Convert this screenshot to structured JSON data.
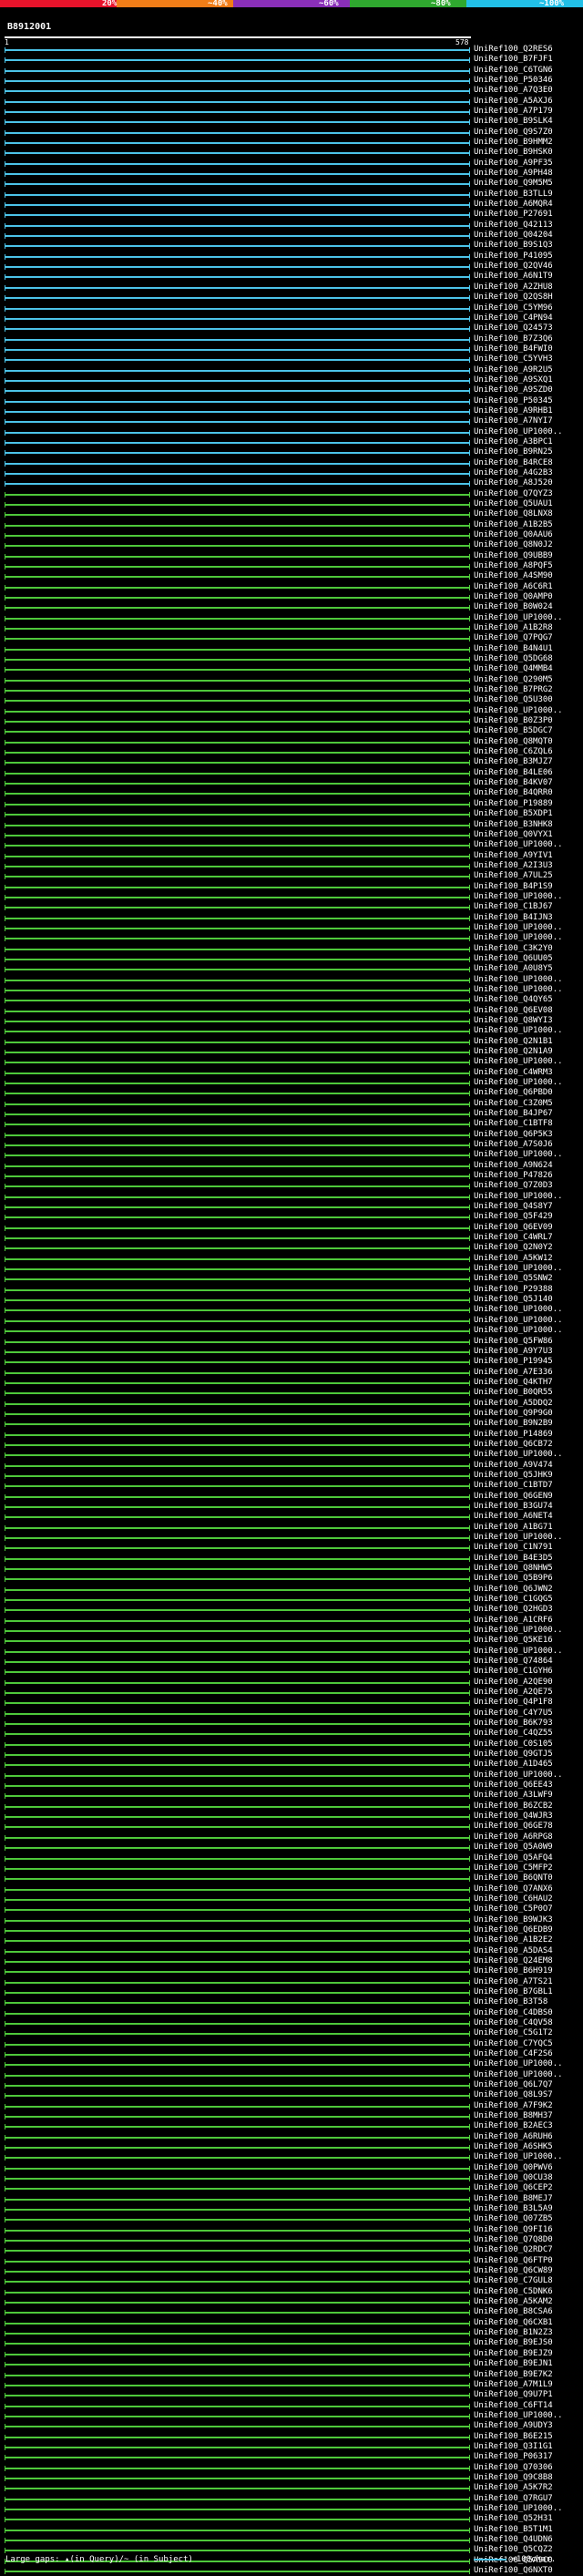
{
  "identity_scale": {
    "labels": [
      "20%",
      "~40%",
      "~60%",
      "~80%",
      "~100%"
    ],
    "colors": [
      "#e8132b",
      "#f07d18",
      "#8a2fb8",
      "#2fa82f",
      "#22c0e8"
    ]
  },
  "query": {
    "id": "B8912001",
    "start": "1",
    "end": "578"
  },
  "hits": [
    {
      "label": "UniRef100_Q2RES6",
      "color": "blue"
    },
    {
      "label": "UniRef100_B7FJF1",
      "color": "blue"
    },
    {
      "label": "UniRef100_C6TGN6",
      "color": "blue"
    },
    {
      "label": "UniRef100_P50346",
      "color": "blue"
    },
    {
      "label": "UniRef100_A7Q3E0",
      "color": "blue"
    },
    {
      "label": "UniRef100_A5AXJ6",
      "color": "blue"
    },
    {
      "label": "UniRef100_A7P179",
      "color": "blue"
    },
    {
      "label": "UniRef100_B9SLK4",
      "color": "blue"
    },
    {
      "label": "UniRef100_Q9S7Z0",
      "color": "blue"
    },
    {
      "label": "UniRef100_B9HMM2",
      "color": "blue"
    },
    {
      "label": "UniRef100_B9HSK0",
      "color": "blue"
    },
    {
      "label": "UniRef100_A9PF35",
      "color": "blue"
    },
    {
      "label": "UniRef100_A9PH48",
      "color": "blue"
    },
    {
      "label": "UniRef100_Q9M5M5",
      "color": "blue"
    },
    {
      "label": "UniRef100_B3TLL9",
      "color": "blue"
    },
    {
      "label": "UniRef100_A6MQR4",
      "color": "blue"
    },
    {
      "label": "UniRef100_P27691",
      "color": "blue"
    },
    {
      "label": "UniRef100_Q42113",
      "color": "blue"
    },
    {
      "label": "UniRef100_Q04204",
      "color": "blue"
    },
    {
      "label": "UniRef100_B9S1Q3",
      "color": "blue"
    },
    {
      "label": "UniRef100_P41095",
      "color": "blue"
    },
    {
      "label": "UniRef100_Q2QV46",
      "color": "blue"
    },
    {
      "label": "UniRef100_A6N1T9",
      "color": "blue"
    },
    {
      "label": "UniRef100_A2ZHU8",
      "color": "blue"
    },
    {
      "label": "UniRef100_Q2QS8H",
      "color": "blue"
    },
    {
      "label": "UniRef100_C5YM96",
      "color": "blue"
    },
    {
      "label": "UniRef100_C4PN94",
      "color": "blue"
    },
    {
      "label": "UniRef100_Q24573",
      "color": "blue"
    },
    {
      "label": "UniRef100_B7Z3Q6",
      "color": "blue"
    },
    {
      "label": "UniRef100_B4FWI0",
      "color": "blue"
    },
    {
      "label": "UniRef100_C5YVH3",
      "color": "blue"
    },
    {
      "label": "UniRef100_A9R2U5",
      "color": "blue"
    },
    {
      "label": "UniRef100_A9SXQ1",
      "color": "blue"
    },
    {
      "label": "UniRef100_A9SZD0",
      "color": "blue"
    },
    {
      "label": "UniRef100_P50345",
      "color": "blue"
    },
    {
      "label": "UniRef100_A9RHB1",
      "color": "blue"
    },
    {
      "label": "UniRef100_A7NYI7",
      "color": "blue"
    },
    {
      "label": "UniRef100_UP1000..",
      "color": "blue"
    },
    {
      "label": "UniRef100_A3BPC1",
      "color": "blue"
    },
    {
      "label": "UniRef100_B9RN25",
      "color": "blue"
    },
    {
      "label": "UniRef100_B4RCE8",
      "color": "blue"
    },
    {
      "label": "UniRef100_A4G2B3",
      "color": "blue"
    },
    {
      "label": "UniRef100_A8J520",
      "color": "blue"
    },
    {
      "label": "UniRef100_Q7QYZ3",
      "color": "green"
    },
    {
      "label": "UniRef100_Q5UAU1",
      "color": "green"
    },
    {
      "label": "UniRef100_Q8LNX8",
      "color": "green"
    },
    {
      "label": "UniRef100_A1B2B5",
      "color": "green"
    },
    {
      "label": "UniRef100_Q0AAU6",
      "color": "green"
    },
    {
      "label": "UniRef100_Q8N0J2",
      "color": "green"
    },
    {
      "label": "UniRef100_Q9UBB9",
      "color": "green"
    },
    {
      "label": "UniRef100_A8PQF5",
      "color": "green"
    },
    {
      "label": "UniRef100_A4SM90",
      "color": "green"
    },
    {
      "label": "UniRef100_A6C6R1",
      "color": "green"
    },
    {
      "label": "UniRef100_Q0AMP0",
      "color": "green"
    },
    {
      "label": "UniRef100_B0W024",
      "color": "green"
    },
    {
      "label": "UniRef100_UP1000..",
      "color": "green"
    },
    {
      "label": "UniRef100_A1B2R8",
      "color": "green"
    },
    {
      "label": "UniRef100_Q7PQG7",
      "color": "green"
    },
    {
      "label": "UniRef100_B4N4U1",
      "color": "green"
    },
    {
      "label": "UniRef100_Q5DG68",
      "color": "green"
    },
    {
      "label": "UniRef100_Q4MMB4",
      "color": "green"
    },
    {
      "label": "UniRef100_Q290M5",
      "color": "green"
    },
    {
      "label": "UniRef100_B7PRG2",
      "color": "green"
    },
    {
      "label": "UniRef100_Q5U300",
      "color": "green"
    },
    {
      "label": "UniRef100_UP1000..",
      "color": "green"
    },
    {
      "label": "UniRef100_B0Z3P0",
      "color": "green"
    },
    {
      "label": "UniRef100_B5DGC7",
      "color": "green"
    },
    {
      "label": "UniRef100_Q8MQT0",
      "color": "green"
    },
    {
      "label": "UniRef100_C6ZQL6",
      "color": "green"
    },
    {
      "label": "UniRef100_B3MJZ7",
      "color": "green"
    },
    {
      "label": "UniRef100_B4LE06",
      "color": "green"
    },
    {
      "label": "UniRef100_B4KV07",
      "color": "green"
    },
    {
      "label": "UniRef100_B4QRR0",
      "color": "green"
    },
    {
      "label": "UniRef100_P19889",
      "color": "green"
    },
    {
      "label": "UniRef100_B5XDP1",
      "color": "green"
    },
    {
      "label": "UniRef100_B3NHK8",
      "color": "green"
    },
    {
      "label": "UniRef100_Q0VYX1",
      "color": "green"
    },
    {
      "label": "UniRef100_UP1000..",
      "color": "green"
    },
    {
      "label": "UniRef100_A9YIV1",
      "color": "green"
    },
    {
      "label": "UniRef100_A2I3U3",
      "color": "green"
    },
    {
      "label": "UniRef100_A7UL25",
      "color": "green"
    },
    {
      "label": "UniRef100_B4P1S9",
      "color": "green"
    },
    {
      "label": "UniRef100_UP1000..",
      "color": "green"
    },
    {
      "label": "UniRef100_C1BJ67",
      "color": "green"
    },
    {
      "label": "UniRef100_B4IJN3",
      "color": "green"
    },
    {
      "label": "UniRef100_UP1000..",
      "color": "green"
    },
    {
      "label": "UniRef100_UP1000..",
      "color": "green"
    },
    {
      "label": "UniRef100_C3K2Y0",
      "color": "green"
    },
    {
      "label": "UniRef100_Q6UU05",
      "color": "green"
    },
    {
      "label": "UniRef100_A0U8Y5",
      "color": "green"
    },
    {
      "label": "UniRef100_UP1000..",
      "color": "green"
    },
    {
      "label": "UniRef100_UP1000..",
      "color": "green"
    },
    {
      "label": "UniRef100_Q4QY65",
      "color": "green"
    },
    {
      "label": "UniRef100_Q6EV08",
      "color": "green"
    },
    {
      "label": "UniRef100_Q8WYI3",
      "color": "green"
    },
    {
      "label": "UniRef100_UP1000..",
      "color": "green"
    },
    {
      "label": "UniRef100_Q2N1B1",
      "color": "green"
    },
    {
      "label": "UniRef100_Q2N1A9",
      "color": "green"
    },
    {
      "label": "UniRef100_UP1000..",
      "color": "green"
    },
    {
      "label": "UniRef100_C4WRM3",
      "color": "green"
    },
    {
      "label": "UniRef100_UP1000..",
      "color": "green"
    },
    {
      "label": "UniRef100_Q6PBD0",
      "color": "green"
    },
    {
      "label": "UniRef100_C3Z0M5",
      "color": "green"
    },
    {
      "label": "UniRef100_B4JP67",
      "color": "green"
    },
    {
      "label": "UniRef100_C1BTF8",
      "color": "green"
    },
    {
      "label": "UniRef100_Q6P5K3",
      "color": "green"
    },
    {
      "label": "UniRef100_A7S0J6",
      "color": "green"
    },
    {
      "label": "UniRef100_UP1000..",
      "color": "green"
    },
    {
      "label": "UniRef100_A9N624",
      "color": "green"
    },
    {
      "label": "UniRef100_P47826",
      "color": "green"
    },
    {
      "label": "UniRef100_Q7Z0D3",
      "color": "green"
    },
    {
      "label": "UniRef100_UP1000..",
      "color": "green"
    },
    {
      "label": "UniRef100_Q4S8Y7",
      "color": "green"
    },
    {
      "label": "UniRef100_Q5F429",
      "color": "green"
    },
    {
      "label": "UniRef100_Q6EV09",
      "color": "green"
    },
    {
      "label": "UniRef100_C4WRL7",
      "color": "green"
    },
    {
      "label": "UniRef100_Q2N0Y2",
      "color": "green"
    },
    {
      "label": "UniRef100_A5KW12",
      "color": "green"
    },
    {
      "label": "UniRef100_UP1000..",
      "color": "green"
    },
    {
      "label": "UniRef100_Q5SNW2",
      "color": "green"
    },
    {
      "label": "UniRef100_P29388",
      "color": "green"
    },
    {
      "label": "UniRef100_Q5J140",
      "color": "green"
    },
    {
      "label": "UniRef100_UP1000..",
      "color": "green"
    },
    {
      "label": "UniRef100_UP1000..",
      "color": "green"
    },
    {
      "label": "UniRef100_UP1000..",
      "color": "green"
    },
    {
      "label": "UniRef100_Q5FW86",
      "color": "green"
    },
    {
      "label": "UniRef100_A9Y7U3",
      "color": "green"
    },
    {
      "label": "UniRef100_P19945",
      "color": "green"
    },
    {
      "label": "UniRef100_A7E336",
      "color": "green"
    },
    {
      "label": "UniRef100_Q4KTH7",
      "color": "green"
    },
    {
      "label": "UniRef100_B0QR55",
      "color": "green"
    },
    {
      "label": "UniRef100_A5DDQ2",
      "color": "green"
    },
    {
      "label": "UniRef100_Q9P9G0",
      "color": "green"
    },
    {
      "label": "UniRef100_B9N2B9",
      "color": "green"
    },
    {
      "label": "UniRef100_P14869",
      "color": "green"
    },
    {
      "label": "UniRef100_Q6CB72",
      "color": "green"
    },
    {
      "label": "UniRef100_UP1000..",
      "color": "green"
    },
    {
      "label": "UniRef100_A9V474",
      "color": "green"
    },
    {
      "label": "UniRef100_Q5JHK9",
      "color": "green"
    },
    {
      "label": "UniRef100_C1BTD7",
      "color": "green"
    },
    {
      "label": "UniRef100_Q6GEN9",
      "color": "green"
    },
    {
      "label": "UniRef100_B3GU74",
      "color": "green"
    },
    {
      "label": "UniRef100_A6NET4",
      "color": "green"
    },
    {
      "label": "UniRef100_A1BG71",
      "color": "green"
    },
    {
      "label": "UniRef100_UP1000..",
      "color": "green"
    },
    {
      "label": "UniRef100_C1N791",
      "color": "green"
    },
    {
      "label": "UniRef100_B4E3D5",
      "color": "green"
    },
    {
      "label": "UniRef100_Q8NHW5",
      "color": "green"
    },
    {
      "label": "UniRef100_Q5B9P6",
      "color": "green"
    },
    {
      "label": "UniRef100_Q6JWN2",
      "color": "green"
    },
    {
      "label": "UniRef100_C1GQG5",
      "color": "green"
    },
    {
      "label": "UniRef100_Q2HGD3",
      "color": "green"
    },
    {
      "label": "UniRef100_A1CRF6",
      "color": "green"
    },
    {
      "label": "UniRef100_UP1000..",
      "color": "green"
    },
    {
      "label": "UniRef100_Q5KE16",
      "color": "green"
    },
    {
      "label": "UniRef100_UP1000..",
      "color": "green"
    },
    {
      "label": "UniRef100_Q74864",
      "color": "green"
    },
    {
      "label": "UniRef100_C1GYH6",
      "color": "green"
    },
    {
      "label": "UniRef100_A2QE90",
      "color": "green"
    },
    {
      "label": "UniRef100_A2QE75",
      "color": "green"
    },
    {
      "label": "UniRef100_Q4P1F8",
      "color": "green"
    },
    {
      "label": "UniRef100_C4Y7U5",
      "color": "green"
    },
    {
      "label": "UniRef100_B6K793",
      "color": "green"
    },
    {
      "label": "UniRef100_C4QZ55",
      "color": "green"
    },
    {
      "label": "UniRef100_C0S105",
      "color": "green"
    },
    {
      "label": "UniRef100_Q9GTJ5",
      "color": "green"
    },
    {
      "label": "UniRef100_A1D465",
      "color": "green"
    },
    {
      "label": "UniRef100_UP1000..",
      "color": "green"
    },
    {
      "label": "UniRef100_Q6EE43",
      "color": "green"
    },
    {
      "label": "UniRef100_A3LWF9",
      "color": "green"
    },
    {
      "label": "UniRef100_B6ZCB2",
      "color": "green"
    },
    {
      "label": "UniRef100_Q4WJR3",
      "color": "green"
    },
    {
      "label": "UniRef100_Q6GE78",
      "color": "green"
    },
    {
      "label": "UniRef100_A6RPG8",
      "color": "green"
    },
    {
      "label": "UniRef100_Q5A0W9",
      "color": "green"
    },
    {
      "label": "UniRef100_Q5AFQ4",
      "color": "green"
    },
    {
      "label": "UniRef100_C5MFP2",
      "color": "green"
    },
    {
      "label": "UniRef100_B6QNT0",
      "color": "green"
    },
    {
      "label": "UniRef100_Q7ANX6",
      "color": "green"
    },
    {
      "label": "UniRef100_C6HAU2",
      "color": "green"
    },
    {
      "label": "UniRef100_C5P0O7",
      "color": "green"
    },
    {
      "label": "UniRef100_B9WJK3",
      "color": "green"
    },
    {
      "label": "UniRef100_Q6EDB9",
      "color": "green"
    },
    {
      "label": "UniRef100_A1B2E2",
      "color": "green"
    },
    {
      "label": "UniRef100_A5DAS4",
      "color": "green"
    },
    {
      "label": "UniRef100_Q24EM8",
      "color": "green"
    },
    {
      "label": "UniRef100_B6H919",
      "color": "green"
    },
    {
      "label": "UniRef100_A7TS21",
      "color": "green"
    },
    {
      "label": "UniRef100_B7GBL1",
      "color": "green"
    },
    {
      "label": "UniRef100_B3T58",
      "color": "green"
    },
    {
      "label": "UniRef100_C4DBS0",
      "color": "green"
    },
    {
      "label": "UniRef100_C4QV58",
      "color": "green"
    },
    {
      "label": "UniRef100_C5G1T2",
      "color": "green"
    },
    {
      "label": "UniRef100_C7YQC5",
      "color": "green"
    },
    {
      "label": "UniRef100_C4F2S6",
      "color": "green"
    },
    {
      "label": "UniRef100_UP1000..",
      "color": "green"
    },
    {
      "label": "UniRef100_UP1000..",
      "color": "green"
    },
    {
      "label": "UniRef100_Q6L7Q7",
      "color": "green"
    },
    {
      "label": "UniRef100_Q8L9S7",
      "color": "green"
    },
    {
      "label": "UniRef100_A7F9K2",
      "color": "green"
    },
    {
      "label": "UniRef100_B8MH37",
      "color": "green"
    },
    {
      "label": "UniRef100_B2AEC3",
      "color": "green"
    },
    {
      "label": "UniRef100_A6RUH6",
      "color": "green"
    },
    {
      "label": "UniRef100_A6SHK5",
      "color": "green"
    },
    {
      "label": "UniRef100_UP1000..",
      "color": "green"
    },
    {
      "label": "UniRef100_Q0PWV6",
      "color": "green"
    },
    {
      "label": "UniRef100_Q0CU38",
      "color": "green"
    },
    {
      "label": "UniRef100_Q6CEP2",
      "color": "green"
    },
    {
      "label": "UniRef100_B8MEJ7",
      "color": "green"
    },
    {
      "label": "UniRef100_B3L5A9",
      "color": "green"
    },
    {
      "label": "UniRef100_Q07ZB5",
      "color": "green"
    },
    {
      "label": "UniRef100_Q9FI16",
      "color": "green"
    },
    {
      "label": "UniRef100_Q7Q8D0",
      "color": "green"
    },
    {
      "label": "UniRef100_Q2RDC7",
      "color": "green"
    },
    {
      "label": "UniRef100_Q6FTP0",
      "color": "green"
    },
    {
      "label": "UniRef100_Q6CW89",
      "color": "green"
    },
    {
      "label": "UniRef100_C7GUL8",
      "color": "green"
    },
    {
      "label": "UniRef100_C5DNK6",
      "color": "green"
    },
    {
      "label": "UniRef100_A5KAM2",
      "color": "green"
    },
    {
      "label": "UniRef100_B8CSA6",
      "color": "green"
    },
    {
      "label": "UniRef100_Q6CXB1",
      "color": "green"
    },
    {
      "label": "UniRef100_B1N2Z3",
      "color": "green"
    },
    {
      "label": "UniRef100_B9EJS0",
      "color": "green"
    },
    {
      "label": "UniRef100_B9EJZ9",
      "color": "green"
    },
    {
      "label": "UniRef100_B9EJN1",
      "color": "green"
    },
    {
      "label": "UniRef100_B9E7K2",
      "color": "green"
    },
    {
      "label": "UniRef100_A7M1L9",
      "color": "green"
    },
    {
      "label": "UniRef100_Q9U7P1",
      "color": "green"
    },
    {
      "label": "UniRef100_C6FT14",
      "color": "green"
    },
    {
      "label": "UniRef100_UP1000..",
      "color": "green"
    },
    {
      "label": "UniRef100_A9UDY3",
      "color": "green"
    },
    {
      "label": "UniRef100_B6E215",
      "color": "green"
    },
    {
      "label": "UniRef100_Q3I1G1",
      "color": "green"
    },
    {
      "label": "UniRef100_P06317",
      "color": "green"
    },
    {
      "label": "UniRef100_Q70306",
      "color": "green"
    },
    {
      "label": "UniRef100_Q9C8B8",
      "color": "green"
    },
    {
      "label": "UniRef100_A5K7R2",
      "color": "green"
    },
    {
      "label": "UniRef100_Q7RGU7",
      "color": "green"
    },
    {
      "label": "UniRef100_UP1000..",
      "color": "green"
    },
    {
      "label": "UniRef100_Q52H31",
      "color": "green"
    },
    {
      "label": "UniRef100_B5T1M1",
      "color": "green"
    },
    {
      "label": "UniRef100_Q4UDN6",
      "color": "green"
    },
    {
      "label": "UniRef100_Q5CQZ2",
      "color": "green"
    },
    {
      "label": "UniRef100_Q5A9C0",
      "color": "green"
    },
    {
      "label": "UniRef100_Q6NXT0",
      "color": "green"
    }
  ],
  "legend": {
    "gaps_text": "Large gaps: ▴(in Query)/~ (in Subject)",
    "scale_text": "=100char."
  }
}
